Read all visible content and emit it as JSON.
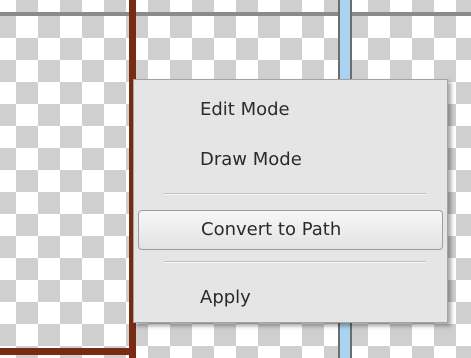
{
  "context_menu": {
    "items": [
      {
        "label": "Edit Mode"
      },
      {
        "label": "Draw Mode"
      },
      {
        "label": "Convert to Path",
        "highlighted": true
      },
      {
        "label": "Apply"
      }
    ]
  },
  "colors": {
    "frame": "#7a2a10",
    "guide_strip": "#a9d3f1",
    "menu_background": "#e5e5e5"
  }
}
